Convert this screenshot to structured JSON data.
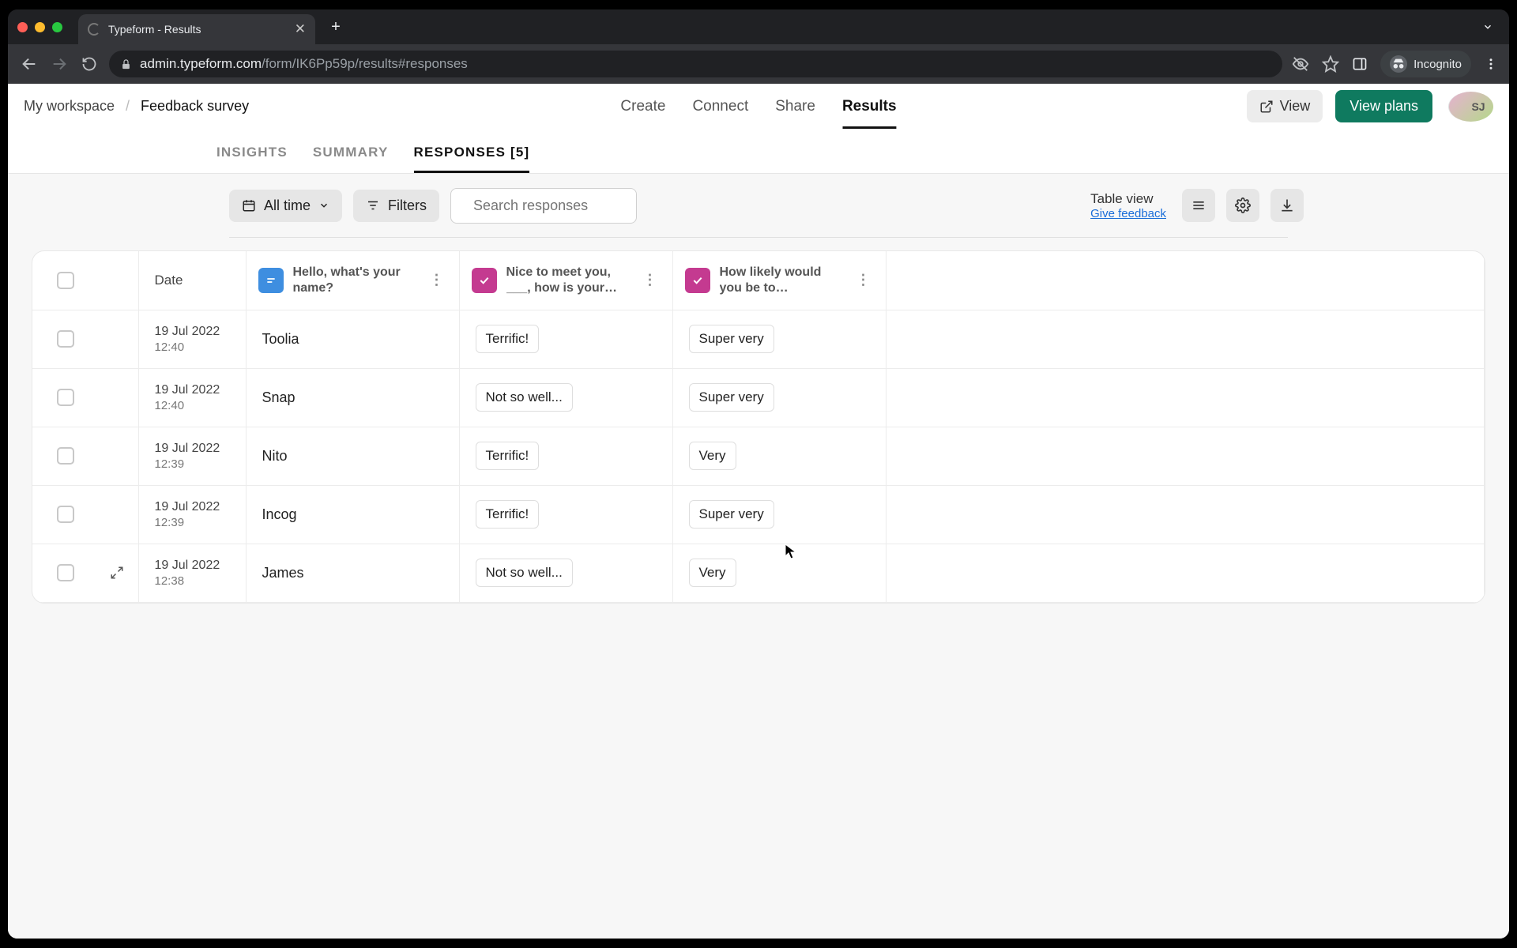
{
  "browser": {
    "tab_title": "Typeform - Results",
    "url_domain": "admin.typeform.com",
    "url_path": "/form/IK6Pp59p/results#responses",
    "incognito_label": "Incognito"
  },
  "appbar": {
    "workspace": "My workspace",
    "breadcrumb_current": "Feedback survey",
    "nav": {
      "create": "Create",
      "connect": "Connect",
      "share": "Share",
      "results": "Results"
    },
    "view_btn": "View",
    "plans_btn": "View plans",
    "avatar_initials": "SJ"
  },
  "subtabs": {
    "insights": "INSIGHTS",
    "summary": "SUMMARY",
    "responses": "RESPONSES [5]"
  },
  "toolbar": {
    "timerange": "All time",
    "filters": "Filters",
    "search_placeholder": "Search responses",
    "table_view_label": "Table view",
    "give_feedback": "Give feedback"
  },
  "columns": {
    "date": "Date",
    "q1": "Hello, what's your name?",
    "q2": "Nice to meet you, ___, how is your da...",
    "q3": "How likely would you be to recommend..."
  },
  "rows": [
    {
      "date": "19 Jul 2022",
      "time": "12:40",
      "name": "Toolia",
      "q2": "Terrific!",
      "q3": "Super very"
    },
    {
      "date": "19 Jul 2022",
      "time": "12:40",
      "name": "Snap",
      "q2": "Not so well...",
      "q3": "Super very"
    },
    {
      "date": "19 Jul 2022",
      "time": "12:39",
      "name": "Nito",
      "q2": "Terrific!",
      "q3": "Very"
    },
    {
      "date": "19 Jul 2022",
      "time": "12:39",
      "name": "Incog",
      "q2": "Terrific!",
      "q3": "Super very"
    },
    {
      "date": "19 Jul 2022",
      "time": "12:38",
      "name": "James",
      "q2": "Not so well...",
      "q3": "Very"
    }
  ]
}
